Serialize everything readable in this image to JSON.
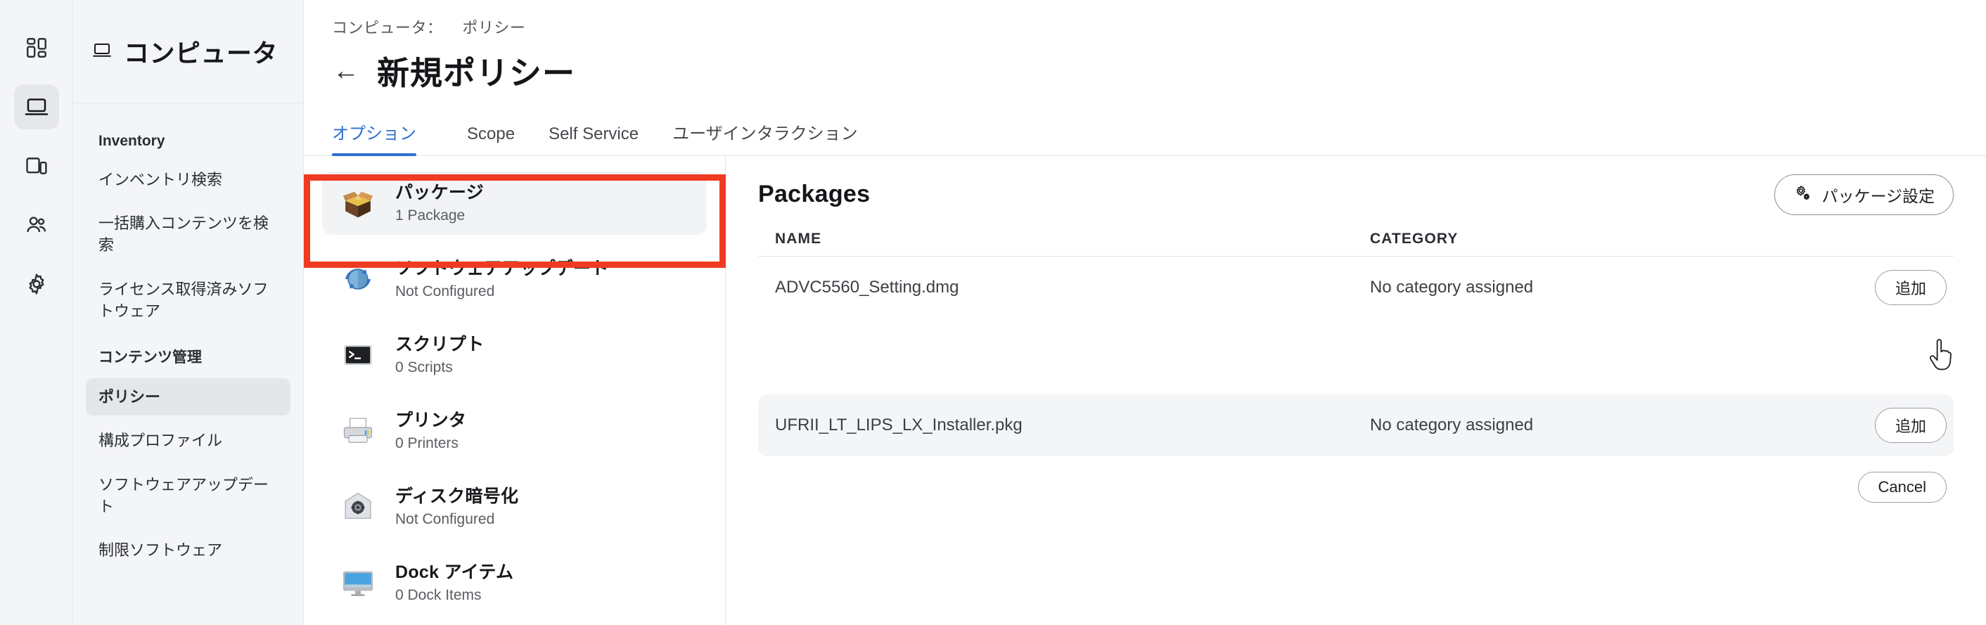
{
  "rail": {
    "items": [
      {
        "name": "dashboard-icon",
        "label": "Dashboard"
      },
      {
        "name": "computers-icon",
        "label": "Computers",
        "active": true
      },
      {
        "name": "devices-icon",
        "label": "Devices"
      },
      {
        "name": "users-icon",
        "label": "Users"
      },
      {
        "name": "settings-icon",
        "label": "Settings"
      }
    ]
  },
  "sidebar": {
    "title": "コンピュータ",
    "groups": [
      {
        "label": "Inventory",
        "items": [
          {
            "label": "インベントリ検索",
            "active": false
          },
          {
            "label": "一括購入コンテンツを検索",
            "active": false
          },
          {
            "label": "ライセンス取得済みソフトウェア",
            "active": false
          }
        ]
      },
      {
        "label": "コンテンツ管理",
        "items": [
          {
            "label": "ポリシー",
            "active": true
          },
          {
            "label": "構成プロファイル",
            "active": false
          },
          {
            "label": "ソフトウェアアップデート",
            "active": false
          },
          {
            "label": "制限ソフトウェア",
            "active": false
          }
        ]
      }
    ]
  },
  "header": {
    "breadcrumb_root": "コンピュータ：",
    "breadcrumb_current": "ポリシー",
    "back_arrow": "←",
    "title": "新規ポリシー"
  },
  "tabs": [
    {
      "label": "オプション",
      "active": true
    },
    {
      "label": "Scope",
      "active": false
    },
    {
      "label": "Self Service",
      "active": false
    },
    {
      "label": "ユーザインタラクション",
      "active": false
    }
  ],
  "payloads": [
    {
      "icon": "package-box-icon",
      "name": "パッケージ",
      "sub": "1 Package",
      "selected": true
    },
    {
      "icon": "software-update-icon",
      "name": "ソフトウェアアップデート",
      "sub": "Not Configured",
      "selected": false
    },
    {
      "icon": "script-terminal-icon",
      "name": "スクリプト",
      "sub": "0 Scripts",
      "selected": false
    },
    {
      "icon": "printer-icon",
      "name": "プリンタ",
      "sub": "0 Printers",
      "selected": false
    },
    {
      "icon": "disk-encryption-icon",
      "name": "ディスク暗号化",
      "sub": "Not Configured",
      "selected": false
    },
    {
      "icon": "dock-items-icon",
      "name": "Dock アイテム",
      "sub": "0 Dock Items",
      "selected": false
    }
  ],
  "packages": {
    "title": "Packages",
    "settings_button": "パッケージ設定",
    "settings_icon": "gears-icon",
    "columns": {
      "name": "NAME",
      "category": "CATEGORY"
    },
    "rows": [
      {
        "name": "ADVC5560_Setting.dmg",
        "category": "No category assigned",
        "action": "追加",
        "shaded": false
      },
      {
        "name": "UFRII_LT_LIPS_LX_Installer.pkg",
        "category": "No category assigned",
        "action": "追加",
        "shaded": true
      }
    ],
    "cancel_button": "Cancel"
  },
  "annotation": {
    "highlight_color": "#ef3b22",
    "cursor": "pointer-hand-cursor"
  },
  "colors": {
    "accent_blue": "#2f6fd0",
    "highlight_red": "#ef3b22",
    "sidebar_bg": "#f4f5f7"
  }
}
